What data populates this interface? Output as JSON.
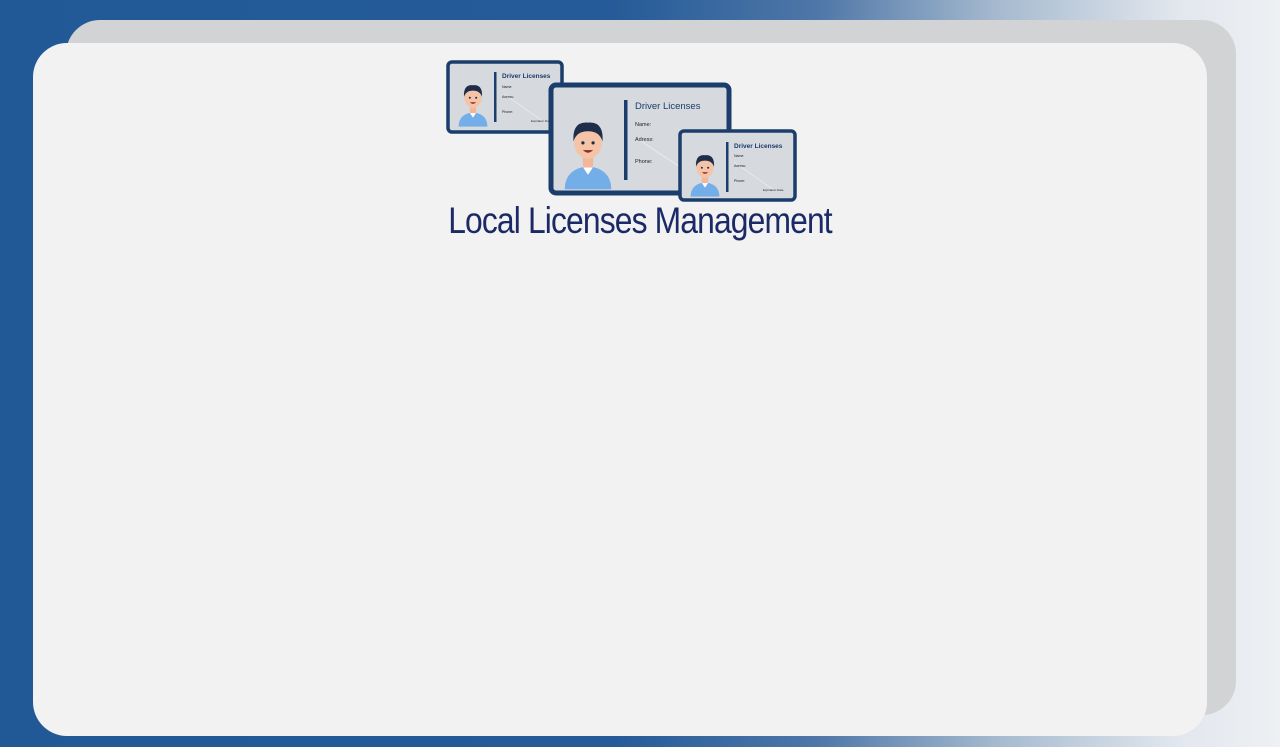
{
  "app": {
    "title": "Local Licenses Management"
  },
  "hero": {
    "card_title": "Driver Licenses",
    "field_name": "Name:",
    "field_address": "Adress:",
    "field_phone": "Phone:",
    "field_expiration": "Expiration Date",
    "icon": "driver-license-cards-icon"
  },
  "colors": {
    "frame_blue": "#215997",
    "card_border": "#1a3d6b",
    "title_text": "#1b2a66",
    "panel_bg": "#f2f2f2"
  }
}
